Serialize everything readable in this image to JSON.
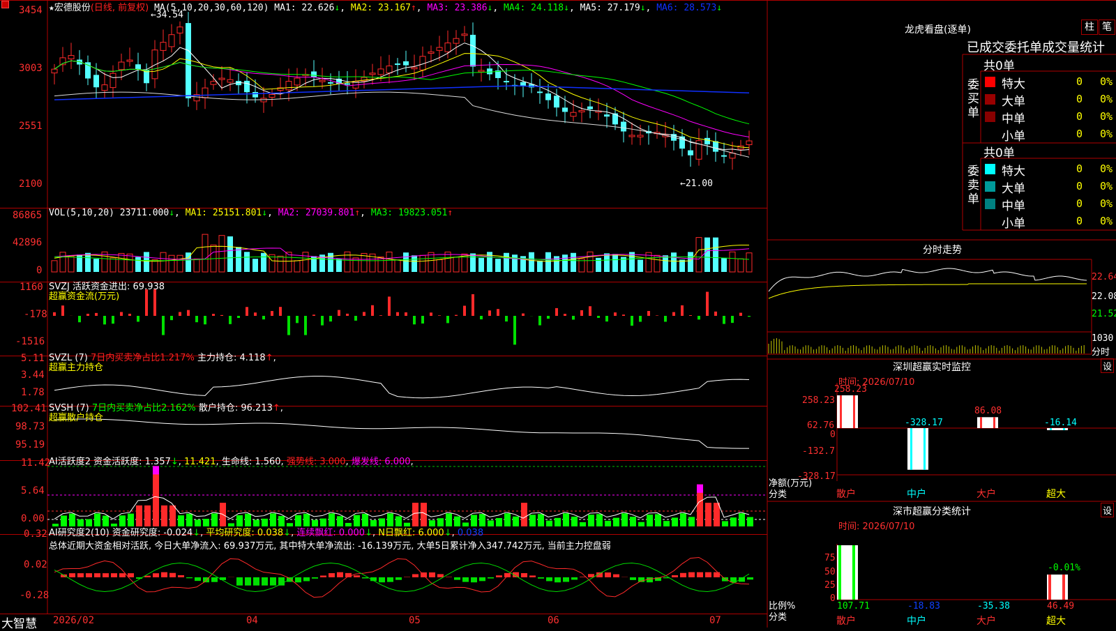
{
  "app": {
    "name": "大智慧"
  },
  "header": {
    "code_icon": "star-icon",
    "stock": "宏德股份",
    "mode": "(日线, 前复权)",
    "ma_label": "MA(5,10,20,30,60,120)",
    "ma1": "MA1: 22.626",
    "ma2": "MA2: 23.167",
    "ma3": "MA3: 23.386",
    "ma4": "MA4: 24.118",
    "ma5": "MA5: 27.179",
    "ma6": "MA6: 28.573",
    "high_mark": "34.54",
    "low_mark": "21.00",
    "colors": {
      "ma1": "#ffffff",
      "ma2": "#ffff00",
      "ma3": "#ff00ff",
      "ma4": "#00ff00",
      "ma5": "#ffffff",
      "ma6": "#1030ff"
    }
  },
  "price_axis": [
    "3454",
    "3003",
    "2551",
    "2100"
  ],
  "vol_panel": {
    "label": "VOL(5,10,20)",
    "value": "23711.000",
    "ma1": "MA1: 25151.801",
    "ma2": "MA2: 27039.801",
    "ma3": "MA3: 19823.051",
    "axis": [
      "86865",
      "42896",
      "0"
    ]
  },
  "svzj_panel": {
    "label": "SVZJ  活跃资金进出: 69.938",
    "sub": "超赢资金流(万元)",
    "axis": [
      "1160",
      "-178",
      "-1516"
    ]
  },
  "svzl_panel": {
    "label": "SVZL (7)",
    "ratio": "7日内买卖净占比1.217%",
    "hold": "主力持仓: 4.118",
    "sub": "超赢主力持仓",
    "axis": [
      "5.11",
      "3.44",
      "1.78"
    ]
  },
  "svsh_panel": {
    "label": "SVSH (7)",
    "ratio": "7日内买卖净占比2.162%",
    "hold": "散户持仓: 96.213",
    "sub": "超赢散户持仓",
    "axis": [
      "102.41",
      "98.73",
      "95.19"
    ]
  },
  "ai_panel": {
    "label": "AI活跃度2",
    "act": "资金活跃度: 1.357",
    "v2": "11.421",
    "life": "生命线: 1.560",
    "strong": "强势线: 3.000",
    "burst": "爆发线: 6.000",
    "axis": [
      "11.42",
      "5.64",
      "0.00"
    ]
  },
  "research_panel": {
    "label": "AI研究度2(10)",
    "res": "资金研究度: -0.024",
    "avg": "平均研究度: 0.038",
    "cont": "连续飘红: 0.000",
    "nday": "N日飘红: 6.000",
    "v5": "0.038",
    "summary": "总体近期大资金相对活跃, 今日大单净流入: 69.937万元, 其中特大单净流出: -16.139万元, 大单5日累计净入347.742万元, 当前主力控盘弱",
    "axis": [
      "0.32",
      "0.02",
      "-0.28"
    ]
  },
  "date_axis": [
    "2026/02",
    "04",
    "05",
    "06",
    "07"
  ],
  "dragon": {
    "title": "龙虎看盘(逐单)",
    "tab1": "柱",
    "tab2": "笔",
    "subtitle": "已成交委托单成交量统计",
    "buy_side": "委买单",
    "sell_side": "委卖单",
    "buy_total": "共0单",
    "sell_total": "共0单",
    "rows": [
      "特大",
      "大单",
      "中单",
      "小单"
    ],
    "buy_vals": [
      "0",
      "0",
      "0",
      "0"
    ],
    "buy_pct": [
      "0%",
      "0%",
      "0%",
      "0%"
    ],
    "sell_vals": [
      "0",
      "0",
      "0",
      "0"
    ],
    "sell_pct": [
      "0%",
      "0%",
      "0%",
      "0%"
    ],
    "buy_colors": [
      "#ff0000",
      "#990000",
      "#880000",
      "#000000"
    ],
    "sell_colors": [
      "#00ffff",
      "#009a9a",
      "#008080",
      "#000000"
    ]
  },
  "intraday": {
    "title": "分时走势",
    "axis": [
      "22.64",
      "22.08",
      "21.52"
    ],
    "vol_axis": "1030",
    "vol_unit": "分时"
  },
  "sz_monitor": {
    "title": "深圳超赢实时监控",
    "set": "设",
    "time": "时间: 2026/07/10",
    "axis": [
      "258.23",
      "62.76",
      "0",
      "-132.7",
      "-328.17"
    ],
    "unit": "净额(万元)",
    "cat_label": "分类",
    "categories": [
      "散户",
      "中户",
      "大户",
      "超大"
    ],
    "values": [
      258.23,
      -328.17,
      86.08,
      -16.14
    ],
    "labels": [
      "258.23",
      "-328.17",
      "86.08",
      "-16.14"
    ]
  },
  "sz_class": {
    "title": "深市超赢分类统计",
    "set": "设",
    "time": "时间: 2026/07/10",
    "axis": [
      "75",
      "50",
      "25",
      "0"
    ],
    "unit": "比例%",
    "cat_label": "分类",
    "categories": [
      "散户",
      "中户",
      "大户",
      "超大"
    ],
    "values": [
      107.71,
      -18.83,
      -35.38,
      46.49
    ],
    "labels": [
      "107.71",
      "-18.83",
      "-35.38",
      "46.49"
    ],
    "top_label": "-0.01%"
  }
}
